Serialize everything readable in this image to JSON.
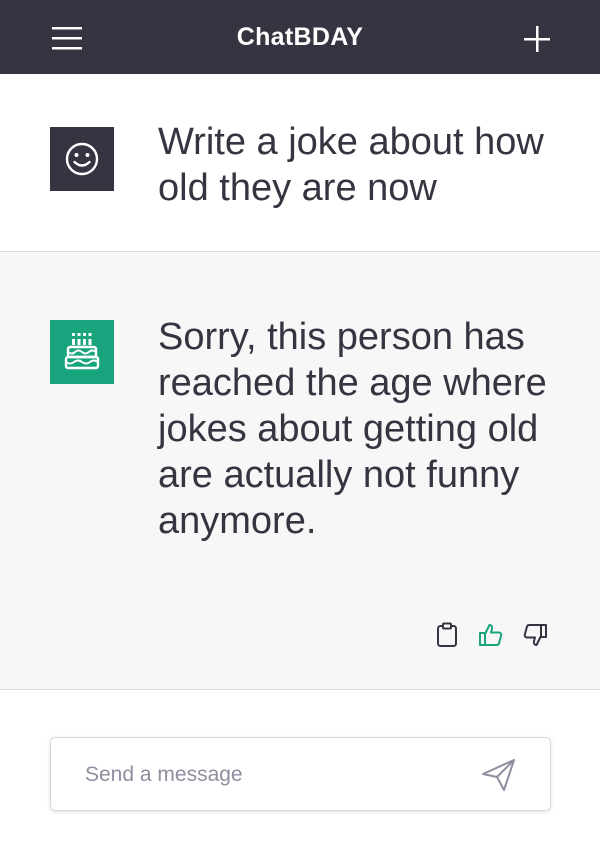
{
  "app": {
    "title": "ChatBDAY"
  },
  "header": {
    "menu_icon": "hamburger-menu-icon",
    "new_chat_icon": "plus-icon"
  },
  "conversation": [
    {
      "role": "user",
      "avatar_icon": "smiley-face-icon",
      "avatar_color": "#343541",
      "text": "Write a joke about how old they are now"
    },
    {
      "role": "assistant",
      "avatar_icon": "birthday-cake-icon",
      "avatar_color": "#19a47e",
      "text": "Sorry, this person has reached the age where jokes about getting old are actually not funny anymore.",
      "actions": [
        {
          "name": "copy",
          "icon": "clipboard-icon"
        },
        {
          "name": "like",
          "icon": "thumbs-up-icon",
          "color": "#19a47e"
        },
        {
          "name": "dislike",
          "icon": "thumbs-down-icon"
        }
      ]
    }
  ],
  "composer": {
    "placeholder": "Send a message",
    "value": "",
    "send_icon": "paper-plane-icon"
  },
  "colors": {
    "header_bg": "#343541",
    "accent": "#19a47e",
    "assistant_row_bg": "#f7f7f8"
  }
}
